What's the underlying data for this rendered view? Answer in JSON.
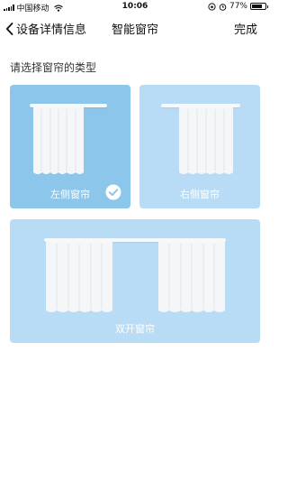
{
  "status_bar": {
    "carrier": "中国移动",
    "time": "10:06",
    "battery_percent": "77%",
    "battery_level": 0.77,
    "icons": [
      "signal-icon",
      "wifi-icon",
      "orientation-lock-icon",
      "alarm-icon",
      "battery-icon"
    ]
  },
  "nav": {
    "back_label": "设备详情信息",
    "title": "智能窗帘",
    "done_label": "完成"
  },
  "section": {
    "label": "请选择窗帘的类型"
  },
  "options": [
    {
      "label": "左侧窗帘",
      "selected": true
    },
    {
      "label": "右侧窗帘",
      "selected": false
    },
    {
      "label": "双开窗帘",
      "selected": false
    }
  ],
  "colors": {
    "selected_card": "#8cc6ea",
    "card": "#b9dcf6",
    "curtain": "#f4f6f8"
  }
}
